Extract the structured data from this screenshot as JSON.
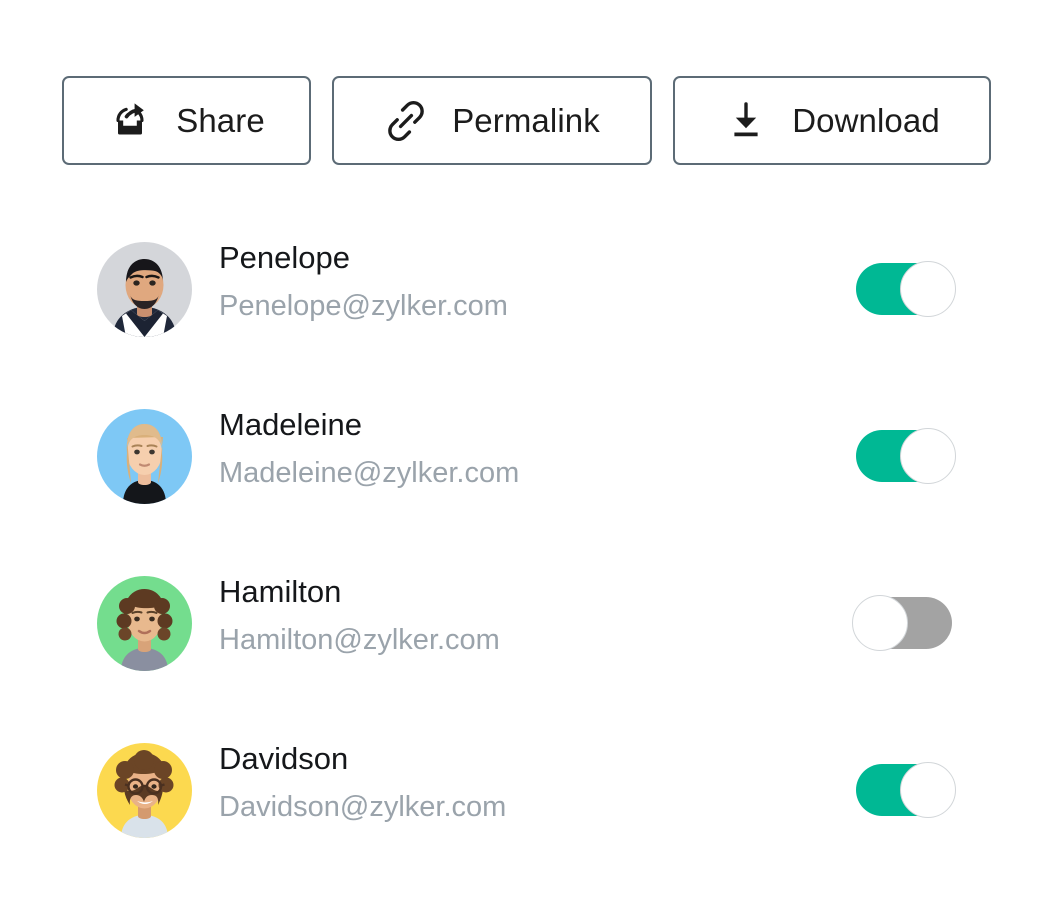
{
  "toolbar": {
    "buttons": [
      {
        "label": "Share",
        "icon": "share-icon",
        "name": "share-button"
      },
      {
        "label": "Permalink",
        "icon": "link-icon",
        "name": "permalink-button"
      },
      {
        "label": "Download",
        "icon": "download-icon",
        "name": "download-button"
      }
    ]
  },
  "colors": {
    "toggle_on": "#00b894",
    "toggle_off": "#a3a3a3",
    "button_border": "#5c6b76",
    "name_text": "#15171a",
    "email_text": "#9aa3ab"
  },
  "people": [
    {
      "name": "Penelope",
      "email": "Penelope@zylker.com",
      "toggle_state": "on",
      "avatar_bg": "#d4d6da"
    },
    {
      "name": "Madeleine",
      "email": "Madeleine@zylker.com",
      "toggle_state": "on",
      "avatar_bg": "#7ec8f5"
    },
    {
      "name": "Hamilton",
      "email": "Hamilton@zylker.com",
      "toggle_state": "off",
      "avatar_bg": "#74dd8e"
    },
    {
      "name": "Davidson",
      "email": "Davidson@zylker.com",
      "toggle_state": "on",
      "avatar_bg": "#fcd94f"
    }
  ]
}
